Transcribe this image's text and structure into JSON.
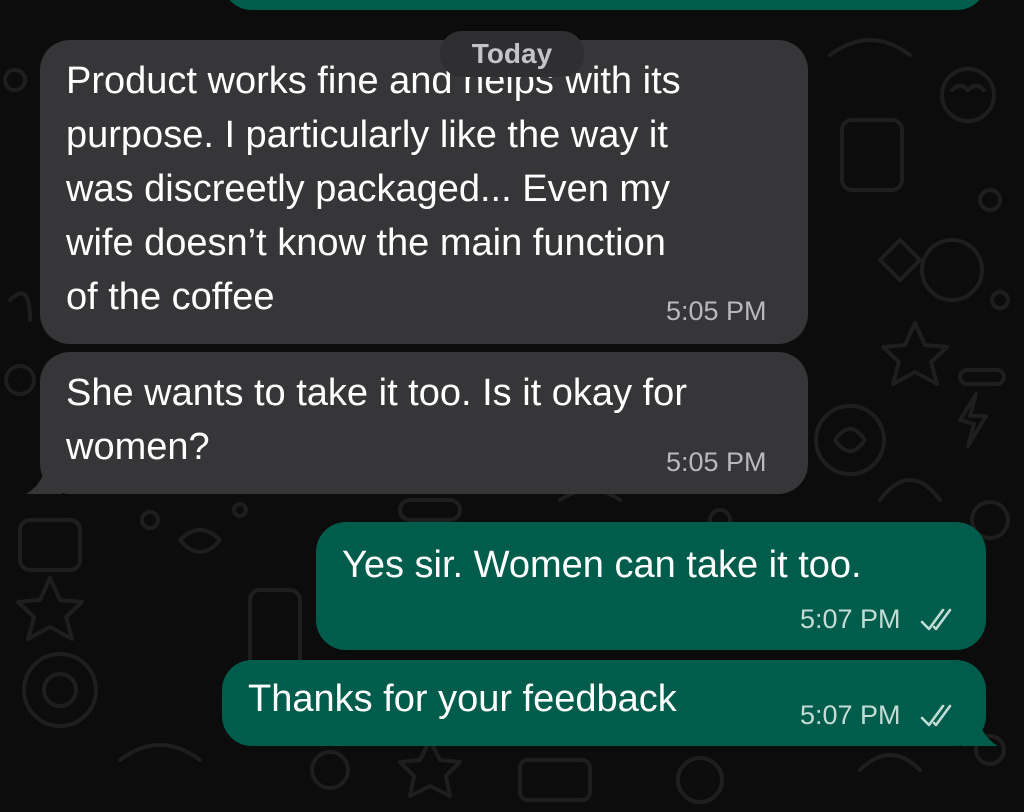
{
  "conversation": {
    "date_label": "Today",
    "messages": [
      {
        "direction": "incoming",
        "lines": [
          "Product works fine and helps with its",
          "purpose. I particularly like the way it",
          "was discreetly packaged... Even my",
          "wife doesn’t know the main function",
          "of the coffee"
        ],
        "time": "5:05 PM"
      },
      {
        "direction": "incoming",
        "lines": [
          "She wants to take it too. Is it okay for",
          "women?"
        ],
        "time": "5:05 PM"
      },
      {
        "direction": "outgoing",
        "lines": [
          "Yes sir. Women can take it too."
        ],
        "time": "5:07 PM",
        "status": "read"
      },
      {
        "direction": "outgoing",
        "lines": [
          "Thanks for your feedback"
        ],
        "time": "5:07 PM",
        "status": "read"
      }
    ]
  },
  "theme": {
    "background": "#0c0c0c",
    "incoming_bubble": "#363638",
    "outgoing_bubble": "#005c4b",
    "read_tick_color": "#c3ddd6"
  },
  "icons": {
    "read_receipt": "double-check-icon"
  }
}
